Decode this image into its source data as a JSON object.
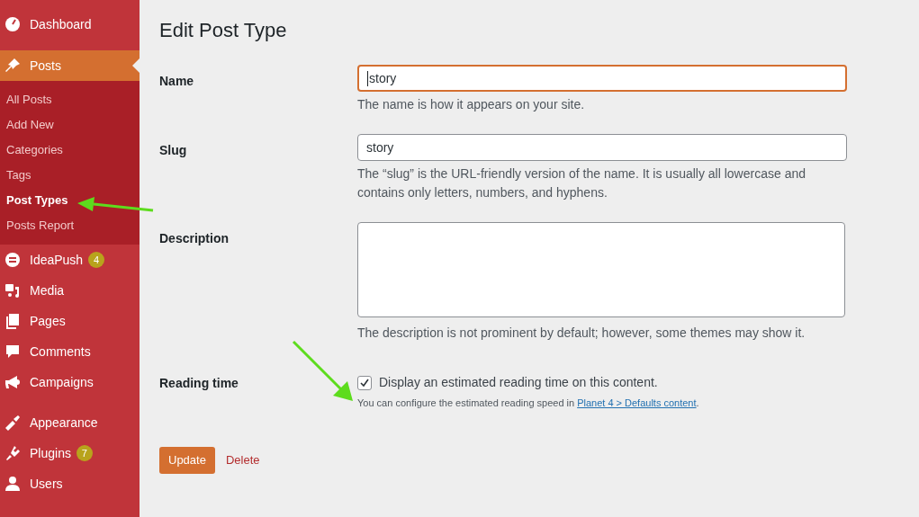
{
  "sidebar": {
    "sections": [
      [
        {
          "label": "Dashboard",
          "selected": false
        }
      ],
      [
        {
          "label": "Posts",
          "selected": true,
          "children": [
            {
              "label": "All Posts",
              "selected": false
            },
            {
              "label": "Add New",
              "selected": false
            },
            {
              "label": "Categories",
              "selected": false
            },
            {
              "label": "Tags",
              "selected": false
            },
            {
              "label": "Post Types",
              "selected": true
            },
            {
              "label": "Posts Report",
              "selected": false
            }
          ]
        },
        {
          "label": "IdeaPush",
          "selected": false,
          "badge": "4"
        },
        {
          "label": "Media",
          "selected": false
        },
        {
          "label": "Pages",
          "selected": false
        },
        {
          "label": "Comments",
          "selected": false
        },
        {
          "label": "Campaigns",
          "selected": false
        }
      ],
      [
        {
          "label": "Appearance",
          "selected": false
        },
        {
          "label": "Plugins",
          "selected": false,
          "badge": "7"
        },
        {
          "label": "Users",
          "selected": false
        }
      ]
    ]
  },
  "page": {
    "title": "Edit Post Type",
    "fields": [
      {
        "kind": "text",
        "label": "Name",
        "value": "story",
        "focused": true,
        "help": "The name is how it appears on your site."
      },
      {
        "kind": "text",
        "label": "Slug",
        "value": "story",
        "focused": false,
        "help": "The “slug” is the URL-friendly version of the name. It is usually all lowercase and contains only letters, numbers, and hyphens."
      },
      {
        "kind": "textarea",
        "label": "Description",
        "help": "The description is not prominent by default; however, some themes may show it."
      },
      {
        "kind": "checkbox",
        "label": "Reading time",
        "checked": true,
        "option": "Display an estimated reading time on this content.",
        "note": "You can configure the estimated reading speed in",
        "link": "Planet 4 > Defaults content",
        "after": "."
      }
    ],
    "buttons": {
      "primary": "Update",
      "delete": "Delete"
    }
  }
}
